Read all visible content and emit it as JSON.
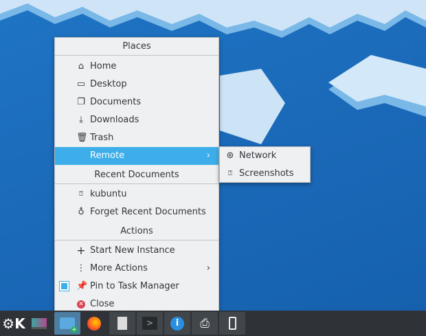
{
  "places": {
    "header": "Places",
    "items": [
      {
        "label": "Home",
        "icon": "home-icon"
      },
      {
        "label": "Desktop",
        "icon": "desktop-icon"
      },
      {
        "label": "Documents",
        "icon": "documents-icon"
      },
      {
        "label": "Downloads",
        "icon": "downloads-icon"
      },
      {
        "label": "Trash",
        "icon": "trash-icon"
      },
      {
        "label": "Remote",
        "icon": "remote-icon",
        "submenu": true
      }
    ]
  },
  "remote_submenu": [
    {
      "label": "Network",
      "icon": "network-icon"
    },
    {
      "label": "Screenshots",
      "icon": "screenshots-icon"
    }
  ],
  "recent": {
    "header": "Recent Documents",
    "items": [
      {
        "label": "kubuntu"
      },
      {
        "label": "Forget Recent Documents"
      }
    ]
  },
  "actions": {
    "header": "Actions",
    "items": [
      {
        "label": "Start New Instance"
      },
      {
        "label": "More Actions"
      },
      {
        "label": "Pin to Task Manager",
        "checked": true
      },
      {
        "label": "Close"
      }
    ]
  },
  "taskbar": [
    "kde-launcher",
    "display-settings",
    "dolphin-file-manager",
    "firefox",
    "document-viewer",
    "terminal",
    "info-center",
    "printer",
    "phone"
  ],
  "colors": {
    "accent": "#3daee9",
    "desktop": "#1a69b8",
    "taskbar": "#2f3337"
  }
}
